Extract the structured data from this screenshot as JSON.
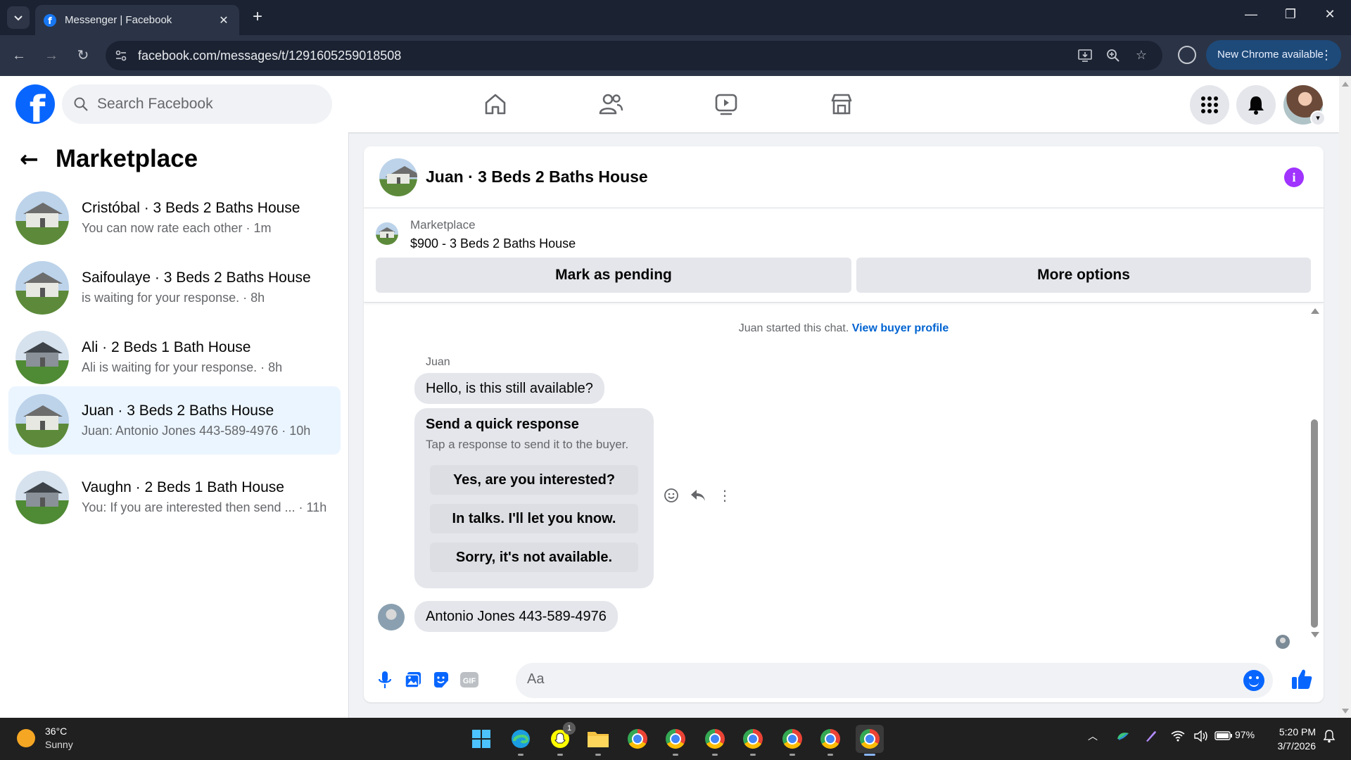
{
  "browser": {
    "tab_title": "Messenger | Facebook",
    "url": "facebook.com/messages/t/1291605259018508",
    "update_label": "New Chrome available"
  },
  "header": {
    "search_placeholder": "Search Facebook"
  },
  "sidebar": {
    "title": "Marketplace",
    "conversations": [
      {
        "title": "Cristóbal · 3 Beds 2 Baths House",
        "subtitle": "You can now rate each other · 1m"
      },
      {
        "title": "Saifoulaye · 3 Beds 2 Baths House",
        "subtitle": "is waiting for your response. · 8h"
      },
      {
        "title": "Ali · 2 Beds 1 Bath House",
        "subtitle": "Ali is waiting for your response. · 8h"
      },
      {
        "title": "Juan · 3 Beds 2 Baths House",
        "subtitle": "Juan: Antonio Jones 443-589-4976 · 10h"
      },
      {
        "title": "Vaughn · 2 Beds 1 Bath House",
        "subtitle": "You: If you are interested then send ... · 11h"
      }
    ]
  },
  "chat": {
    "title": "Juan · 3 Beds 2 Baths House",
    "marketplace_label": "Marketplace",
    "listing": "$900 - 3 Beds 2 Baths House",
    "mark_pending": "Mark as pending",
    "more_options": "More options",
    "started_text": "Juan started this chat.",
    "view_buyer_profile": "View buyer profile",
    "sender_name": "Juan",
    "message_1": "Hello, is this still available?",
    "quick_title": "Send a quick response",
    "quick_subtitle": "Tap a response to send it to the buyer.",
    "quick_responses": [
      "Yes, are you interested?",
      "In talks. I'll let you know.",
      "Sorry, it's not available."
    ],
    "message_2": "Antonio Jones 443-589-4976",
    "composer_placeholder": "Aa"
  },
  "taskbar": {
    "temperature": "36°C",
    "weather": "Sunny",
    "snapchat_badge": "1",
    "battery": "97%",
    "time": "5:20 PM",
    "date": "3/7/2026"
  },
  "colors": {
    "facebook_blue": "#0866ff",
    "active_conversation": "#ebf5ff",
    "info_purple": "#a033ff",
    "link_blue": "#0064d1"
  }
}
